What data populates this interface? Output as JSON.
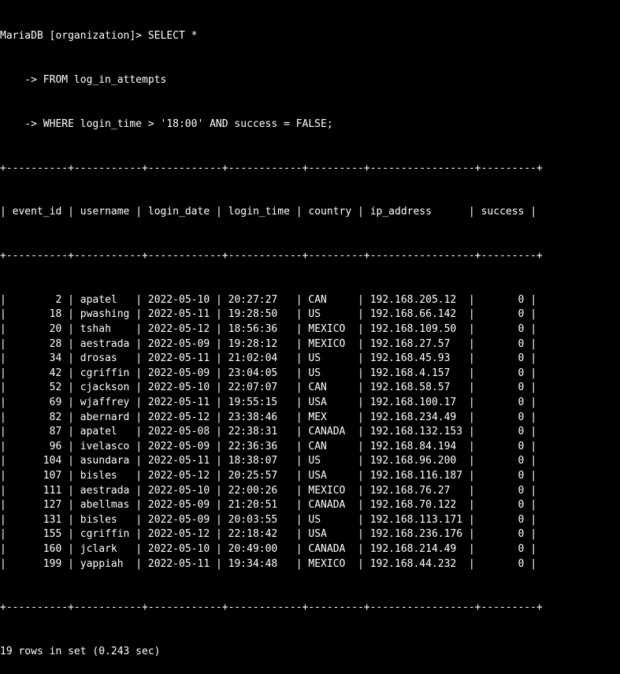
{
  "terminal": {
    "background": "#000000",
    "foreground": "#ffffff",
    "query_lines": [
      "MariaDB [organization]> SELECT *",
      "    -> FROM log_in_attempts",
      "    -> WHERE login_time > '18:00' AND success = FALSE;"
    ],
    "border_line": "+----------+-----------+------------+------------+---------+-----------------+---------+",
    "table": {
      "columns": [
        "event_id",
        "username",
        "login_date",
        "login_time",
        "country",
        "ip_address",
        "success"
      ],
      "rows": [
        [
          "2",
          "apatel",
          "2022-05-10",
          "20:27:27",
          "CAN",
          "192.168.205.12",
          "0"
        ],
        [
          "18",
          "pwashing",
          "2022-05-11",
          "19:28:50",
          "US",
          "192.168.66.142",
          "0"
        ],
        [
          "20",
          "tshah",
          "2022-05-12",
          "18:56:36",
          "MEXICO",
          "192.168.109.50",
          "0"
        ],
        [
          "28",
          "aestrada",
          "2022-05-09",
          "19:28:12",
          "MEXICO",
          "192.168.27.57",
          "0"
        ],
        [
          "34",
          "drosas",
          "2022-05-11",
          "21:02:04",
          "US",
          "192.168.45.93",
          "0"
        ],
        [
          "42",
          "cgriffin",
          "2022-05-09",
          "23:04:05",
          "US",
          "192.168.4.157",
          "0"
        ],
        [
          "52",
          "cjackson",
          "2022-05-10",
          "22:07:07",
          "CAN",
          "192.168.58.57",
          "0"
        ],
        [
          "69",
          "wjaffrey",
          "2022-05-11",
          "19:55:15",
          "USA",
          "192.168.100.17",
          "0"
        ],
        [
          "82",
          "abernard",
          "2022-05-12",
          "23:38:46",
          "MEX",
          "192.168.234.49",
          "0"
        ],
        [
          "87",
          "apatel",
          "2022-05-08",
          "22:38:31",
          "CANADA",
          "192.168.132.153",
          "0"
        ],
        [
          "96",
          "ivelasco",
          "2022-05-09",
          "22:36:36",
          "CAN",
          "192.168.84.194",
          "0"
        ],
        [
          "104",
          "asundara",
          "2022-05-11",
          "18:38:07",
          "US",
          "192.168.96.200",
          "0"
        ],
        [
          "107",
          "bisles",
          "2022-05-12",
          "20:25:57",
          "USA",
          "192.168.116.187",
          "0"
        ],
        [
          "111",
          "aestrada",
          "2022-05-10",
          "22:00:26",
          "MEXICO",
          "192.168.76.27",
          "0"
        ],
        [
          "127",
          "abellmas",
          "2022-05-09",
          "21:20:51",
          "CANADA",
          "192.168.70.122",
          "0"
        ],
        [
          "131",
          "bisles",
          "2022-05-09",
          "20:03:55",
          "US",
          "192.168.113.171",
          "0"
        ],
        [
          "155",
          "cgriffin",
          "2022-05-12",
          "22:18:42",
          "USA",
          "192.168.236.176",
          "0"
        ],
        [
          "160",
          "jclark",
          "2022-05-10",
          "20:49:00",
          "CANADA",
          "192.168.214.49",
          "0"
        ],
        [
          "199",
          "yappiah",
          "2022-05-11",
          "19:34:48",
          "MEXICO",
          "192.168.44.232",
          "0"
        ]
      ]
    },
    "result_summary": "19 rows in set (0.243 sec)"
  }
}
